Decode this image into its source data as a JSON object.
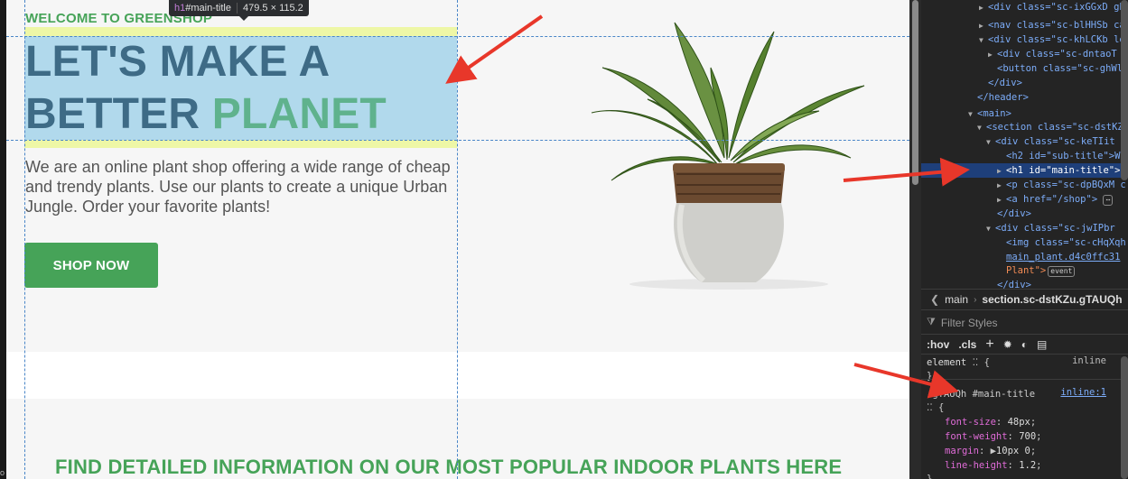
{
  "page": {
    "sub_title": "WELCOME TO GREENSHOP",
    "main_title_line1": "LET'S MAKE A",
    "main_title_line2_a": "BETTER ",
    "main_title_line2_b": "PLANET",
    "description": "We are an online plant shop offering a wide range of cheap and trendy plants. Use our plants to create a unique Urban Jungle. Order your favorite plants!",
    "shop_button": "SHOP NOW",
    "find_title": "FIND DETAILED INFORMATION ON OUR MOST POPULAR INDOOR PLANTS HERE",
    "edge_char": "o"
  },
  "inspector_tooltip": {
    "tag": "h1",
    "id": "#main-title",
    "size": "479.5 × 115.2"
  },
  "devtools": {
    "dom_lines": [
      {
        "t": "<div class=\"sc-ixGGxD gb"
      },
      {
        "t": "<nav class=\"sc-blHHSb ca"
      },
      {
        "t": "<div class=\"sc-khLCKb le"
      },
      {
        "t": "<div class=\"sc-dntaoT"
      },
      {
        "t": "<button class=\"sc-ghWl"
      },
      {
        "t": "</div>"
      },
      {
        "t": "</header>"
      },
      {
        "t": "<main>"
      },
      {
        "t": "<section class=\"sc-dstKZ"
      },
      {
        "t": "<div class=\"sc-keTIit"
      },
      {
        "t": "<h2 id=\"sub-title\">Wh"
      },
      {
        "t": "<h1 id=\"main-title\">"
      },
      {
        "t": "<p class=\"sc-dpBQxM c"
      },
      {
        "t": "<a href=\"/shop\">"
      },
      {
        "t": "</div>"
      },
      {
        "t": "<div class=\"sc-jwIPbr"
      },
      {
        "t": "<img class=\"sc-cHqXqh"
      },
      {
        "t": "main_plant.d4c0ffc31"
      },
      {
        "t": "Plant\">"
      },
      {
        "t": "</div>"
      }
    ],
    "event_badge": "event",
    "breadcrumbs": [
      "main",
      "section.sc-dstKZu.gTAUQh"
    ],
    "filter_placeholder": "Filter Styles",
    "toolbar": [
      ":hov",
      ".cls",
      "+"
    ],
    "element_selector": "element",
    "element_brace": "{",
    "element_close": "}",
    "inline_label": "inline",
    "rule_selector": ".gTAUQh #main-title",
    "rule_source": "inline:1",
    "rule_open": "{",
    "rule_close": "}",
    "properties": [
      {
        "name": "font-size",
        "value": "48px"
      },
      {
        "name": "font-weight",
        "value": "700"
      },
      {
        "name": "margin",
        "value": "10px 0"
      },
      {
        "name": "line-height",
        "value": "1.2"
      }
    ]
  },
  "colors": {
    "brand_green": "#46a358",
    "title_blue": "#3e6b86",
    "title_accent": "#5fb28d",
    "highlight_content": "#b1d9ec",
    "highlight_margin": "#eef7a6",
    "annotation_arrow": "#e8372a",
    "devtools_bg": "#242424",
    "devtools_selected": "#1e3f7a"
  },
  "icons": [
    "chevron-left-icon",
    "filter-icon",
    "plus-icon",
    "sun-icon",
    "contrast-icon",
    "document-icon",
    "flex-icon",
    "red-annotation-arrow"
  ]
}
